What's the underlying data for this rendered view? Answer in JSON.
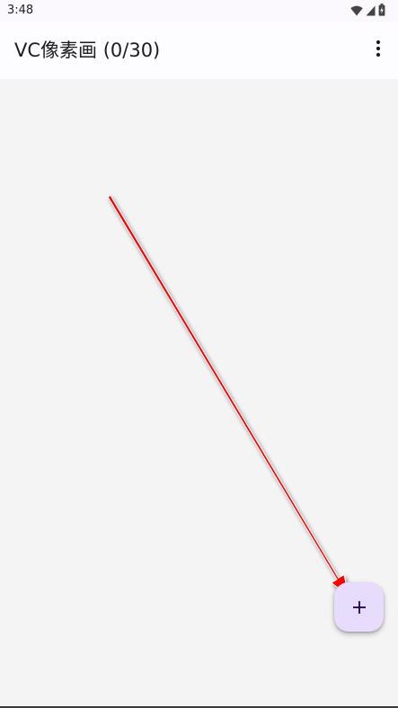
{
  "status_bar": {
    "time": "3:48",
    "icons": [
      "wifi-icon",
      "cell-signal-icon",
      "battery-icon"
    ]
  },
  "app_bar": {
    "title": "VC像素画 (0/30)",
    "overflow_icon": "more-vert-icon"
  },
  "fab": {
    "icon": "plus-icon"
  },
  "annotation": {
    "arrow_color": "#ff0000"
  },
  "colors": {
    "fab_background": "#e7dcfb",
    "content_background": "#f4f4f5",
    "app_bar_background": "#fdfcff"
  }
}
